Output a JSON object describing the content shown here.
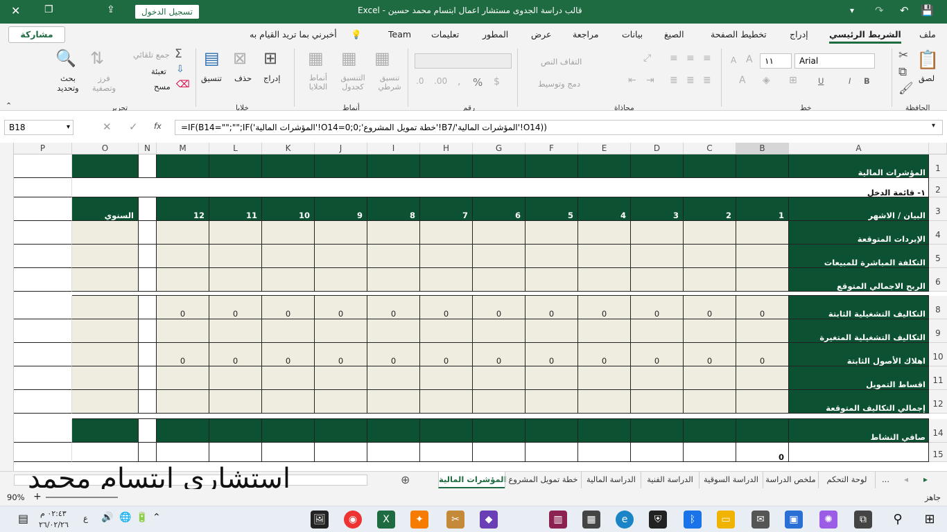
{
  "window": {
    "title": "قالب دراسة الجدوى مستشار اعمال ابتسام محمد حسين  -  Excel",
    "signin_label": "تسجيل الدخول",
    "controls": [
      "close-icon",
      "restore-icon",
      "ribbon-display-icon"
    ]
  },
  "quick_access": {
    "save_icon": "save-icon",
    "undo_icon": "undo-icon",
    "redo_icon": "redo-icon",
    "customize_icon": "chevron-down-icon"
  },
  "menu": {
    "tabs": [
      "ملف",
      "الشريط الرئيسي",
      "إدراج",
      "تخطيط الصفحة",
      "الصيغ",
      "بيانات",
      "مراجعة",
      "عرض",
      "المطور",
      "تعليمات",
      "Team"
    ],
    "active_tab": "الشريط الرئيسي",
    "tell_me": "أخبرني بما تريد القيام به",
    "share_label": "مشاركة"
  },
  "ribbon": {
    "clipboard": {
      "group": "الحافظة",
      "paste": "لصق"
    },
    "font": {
      "group": "خط",
      "font_name": "Arial",
      "font_size": "١١",
      "bold": "B",
      "italic": "I",
      "underline": "U"
    },
    "alignment": {
      "group": "محاذاة",
      "wrap": "التفاف النص",
      "merge": "دمج وتوسيط"
    },
    "number": {
      "group": "رقم",
      "format": "",
      "percent": "%"
    },
    "styles": {
      "group": "أنماط",
      "conditional": "تنسيق شرطي",
      "table": "التنسيق كجدول",
      "cell_styles": "أنماط الخلايا"
    },
    "cells": {
      "group": "خلايا",
      "insert": "إدراج",
      "delete": "حذف",
      "format": "تنسيق"
    },
    "editing": {
      "group": "تحرير",
      "autosum": "جمع تلقائي",
      "fill": "تعبئة",
      "clear": "مسح",
      "sort": "فرز وتصفية",
      "find": "بحث وتحديد"
    }
  },
  "formula_bar": {
    "name_box": "B18",
    "fx": "fx",
    "formula": "=IF(B14=\"\";\"\";IF('المؤشرات المالية'!O14=0;0;'خطة تمويل المشروع'!B7/'المؤشرات المالية'!O14))"
  },
  "grid": {
    "columns": [
      "P",
      "O",
      "N",
      "M",
      "L",
      "K",
      "J",
      "I",
      "H",
      "G",
      "F",
      "E",
      "D",
      "C",
      "B",
      "A"
    ],
    "rows": [
      {
        "num": "1",
        "label": "المؤشرات المالية",
        "values": [
          "",
          "",
          "",
          "",
          "",
          "",
          "",
          "",
          "",
          "",
          "",
          "",
          "",
          ""
        ]
      },
      {
        "num": "2",
        "label": "١-  قائمة الدخل",
        "values": []
      },
      {
        "num": "3",
        "label": "البيان / الاشهر",
        "values": [
          "السنوي",
          "",
          "12",
          "11",
          "10",
          "9",
          "8",
          "7",
          "6",
          "5",
          "4",
          "3",
          "2",
          "1"
        ]
      },
      {
        "num": "4",
        "label": "الإيردات المتوقعة",
        "values": [
          "",
          "",
          "",
          "",
          "",
          "",
          "",
          "",
          "",
          "",
          "",
          "",
          "",
          ""
        ]
      },
      {
        "num": "5",
        "label": "التكلفة المباشرة للمبيعات",
        "values": [
          "",
          "",
          "",
          "",
          "",
          "",
          "",
          "",
          "",
          "",
          "",
          "",
          "",
          ""
        ]
      },
      {
        "num": "6",
        "label": "الربح الاجمالي المتوقع",
        "values": [
          "",
          "",
          "",
          "",
          "",
          "",
          "",
          "",
          "",
          "",
          "",
          "",
          "",
          ""
        ]
      },
      {
        "num": "8",
        "label": "التكاليف التشغيلية الثابتة",
        "values": [
          "",
          "",
          "0",
          "0",
          "0",
          "0",
          "0",
          "0",
          "0",
          "0",
          "0",
          "0",
          "0",
          "0"
        ]
      },
      {
        "num": "9",
        "label": "التكاليف التشغيلية المتغيرة",
        "values": [
          "",
          "",
          "",
          "",
          "",
          "",
          "",
          "",
          "",
          "",
          "",
          "",
          "",
          ""
        ]
      },
      {
        "num": "10",
        "label": "اهلاك الأصول الثابتة",
        "values": [
          "",
          "",
          "0",
          "0",
          "0",
          "0",
          "0",
          "0",
          "0",
          "0",
          "0",
          "0",
          "0",
          "0"
        ]
      },
      {
        "num": "11",
        "label": "اقساط التمويل",
        "values": [
          "",
          "",
          "",
          "",
          "",
          "",
          "",
          "",
          "",
          "",
          "",
          "",
          "",
          ""
        ]
      },
      {
        "num": "12",
        "label": "إجمالي التكاليف المتوقعة",
        "values": [
          "",
          "",
          "",
          "",
          "",
          "",
          "",
          "",
          "",
          "",
          "",
          "",
          "",
          ""
        ]
      },
      {
        "num": "14",
        "label": "صافي النشاط",
        "values": [
          "",
          "",
          "",
          "",
          "",
          "",
          "",
          "",
          "",
          "",
          "",
          "",
          "",
          ""
        ]
      },
      {
        "num": "15",
        "label": "",
        "values": [
          "",
          "",
          "",
          "",
          "",
          "",
          "",
          "",
          "",
          "",
          "",
          "",
          "",
          "0"
        ]
      }
    ]
  },
  "sheets": [
    "المؤشرات المالية",
    "خطة تمويل المشروع",
    "الدراسة المالية",
    "الدراسة الفنية",
    "الدراسة السوقية",
    "ملخص الدراسة",
    "لوحة التحكم",
    "..."
  ],
  "active_sheet": "المؤشرات المالية",
  "status": {
    "ready": "جاهز",
    "zoom": "90%"
  },
  "signature": "استشاري  ابتسام  محمد",
  "taskbar": {
    "time": "٠٢:٤٣ م",
    "date": "٢٦/٠٢/٢٦",
    "lang": "ع",
    "notif": "١"
  }
}
